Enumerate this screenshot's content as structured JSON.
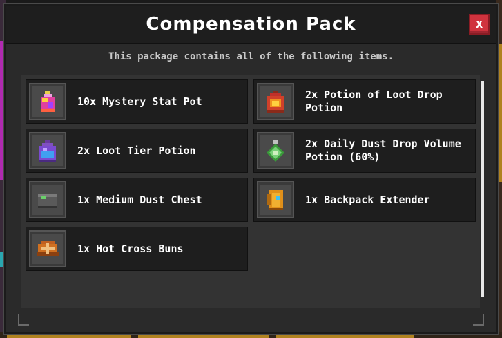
{
  "dialog": {
    "title": "Compensation Pack",
    "close_label": "x",
    "subtitle": "This package contains all of the following items."
  },
  "items": [
    {
      "label": "10x Mystery Stat Pot",
      "icon": "mystery-stat-pot-icon"
    },
    {
      "label": "2x Potion of Loot Drop Potion",
      "icon": "loot-drop-potion-icon"
    },
    {
      "label": "2x Loot Tier Potion",
      "icon": "loot-tier-potion-icon"
    },
    {
      "label": "2x Daily Dust Drop Volume Potion (60%)",
      "icon": "dust-volume-potion-icon"
    },
    {
      "label": "1x Medium Dust Chest",
      "icon": "dust-chest-icon"
    },
    {
      "label": "1x Backpack Extender",
      "icon": "backpack-extender-icon"
    },
    {
      "label": "1x Hot Cross Buns",
      "icon": "hot-cross-buns-icon"
    }
  ],
  "colors": {
    "close_button": "#d0333e",
    "item_background": "#1e1e1e",
    "panel_background": "#333333"
  }
}
